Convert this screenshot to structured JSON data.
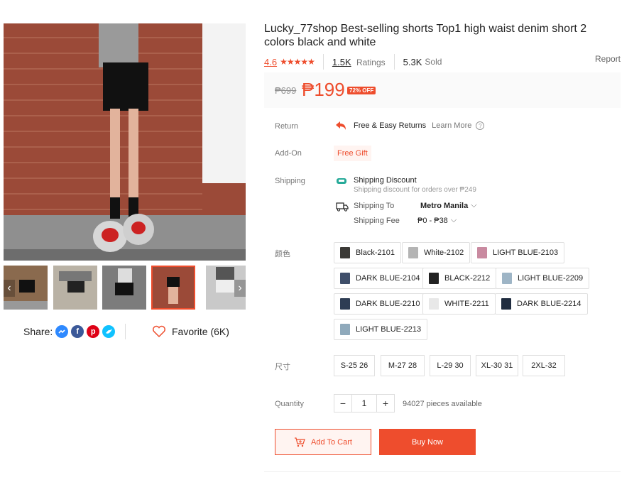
{
  "product": {
    "title": "Lucky_77shop Best-selling shorts Top1 high waist denim short 2 colors black and white",
    "rating": "4.6",
    "stars": "★★★★★",
    "ratings_count": "1.5K",
    "ratings_label": "Ratings",
    "sold_count": "5.3K",
    "sold_label": "Sold",
    "report_label": "Report",
    "old_price": "₱699",
    "price": "₱199",
    "discount": "72% OFF"
  },
  "gallery": {
    "prev_icon": "‹",
    "next_icon": "›"
  },
  "share": {
    "label": "Share:",
    "favorite": "Favorite (6K)"
  },
  "details": {
    "return_label": "Return",
    "return_text": "Free & Easy Returns",
    "learn_more": "Learn More",
    "addon_label": "Add-On",
    "addon_value": "Free Gift",
    "shipping_label": "Shipping",
    "shipping_discount": "Shipping Discount",
    "shipping_discount_note": "Shipping discount for orders over ₱249",
    "shipping_to_label": "Shipping To",
    "shipping_to_value": "Metro Manila",
    "shipping_fee_label": "Shipping Fee",
    "shipping_fee_value": "₱0 - ₱38"
  },
  "variations": {
    "color_label": "颜色",
    "colors": [
      "Black-2101",
      "White-2102",
      "LIGHT BLUE-2103",
      "DARK BLUE-2104",
      "BLACK-2212",
      "LIGHT BLUE-2209",
      "DARK BLUE-2210",
      "WHITE-2211",
      "DARK BLUE-2214",
      "LIGHT BLUE-2213"
    ],
    "size_label": "尺寸",
    "sizes": [
      "S-25 26",
      "M-27 28",
      "L-29 30",
      "XL-30 31",
      "2XL-32"
    ]
  },
  "quantity": {
    "label": "Quantity",
    "minus": "−",
    "value": "1",
    "plus": "+",
    "available": "94027 pieces available"
  },
  "actions": {
    "add_to_cart": "Add To Cart",
    "buy_now": "Buy Now"
  },
  "colors": {
    "accent": "#ee4d2d",
    "facebook_messenger": "#2e89ff",
    "facebook": "#3b5999",
    "pinterest": "#de0217",
    "twitter": "#10c2ff"
  }
}
